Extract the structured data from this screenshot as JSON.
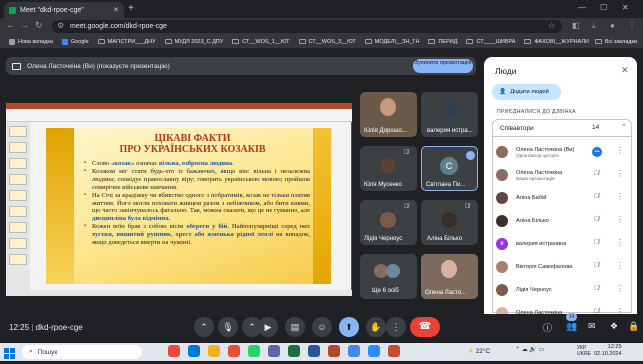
{
  "browser": {
    "tab_title": "Meet \"dkd-rpoe-cge\"",
    "url": "meet.google.com/dkd-rpoe-cge",
    "bookmarks": [
      "Нова вкладка",
      "Google",
      "МАГІСТРИ___ДНУ",
      "МУДЛ 2023_С ДПУ",
      "СТ__WOS_1__ЮТ",
      "СТ__WOS_3__ЮТ",
      "МОДЕЛІ__ЗН_ГН",
      "ПЕРИД",
      "СТ____ШИВРА",
      "ФАХОВІ__ЖУРНАЛИ"
    ],
    "bookmarks_all": "Всі закладки"
  },
  "presentation_bar": {
    "text": "Олена Ласточкіна (Ви) (показуєте презентацію)",
    "stop_button": "Зупинити презентацію"
  },
  "slide": {
    "title_line1": "ЦІКАВІ ФАКТИ",
    "title_line2": "ПРО УКРАЇНСЬКИХ КОЗАКІВ",
    "bullets": [
      {
        "parts": [
          [
            "Слово «",
            false
          ],
          [
            "козак",
            true
          ],
          [
            "» означає ",
            false
          ],
          [
            "вільна, озброєна людина",
            true
          ],
          [
            ".",
            false
          ]
        ]
      },
      {
        "parts": [
          [
            "Козаком міг стати будь-хто із бажаючих, якщо він: ",
            false
          ],
          [
            "вільна і незалежна людина; сповідує православну віру; говорить українською мовою; пройшов семирічне військове навчання.",
            false
          ]
        ]
      },
      {
        "parts": [
          [
            "На Січі за крадіжку чи вбивство одного з побратимів, козак не тільки платив життям. Його могли поховати живцем разом з небіжчиком, або бити киями, що часто закінчувалось фатально. Так, можна сказати, що це не гуманно, але ",
            false
          ],
          [
            "дисципліна була відмінна.",
            true
          ]
        ]
      },
      {
        "parts": [
          [
            "Кожен воїн брав з собою вісім ",
            false
          ],
          [
            "обереги у бій",
            true
          ],
          [
            ". Найпопулярніші серед них ",
            false
          ],
          [
            "хустки, вишитий рушник, хрест або жменька рідної землі",
            true
          ],
          [
            " на випадок, якщо доведеться вмерти на чужині.",
            false
          ]
        ]
      }
    ]
  },
  "tiles": [
    {
      "name": "Юлія Дорошо..."
    },
    {
      "name": "валерия истра..."
    },
    {
      "name": "Юля Мусенко"
    },
    {
      "name": "Світлана Пи...",
      "initial": "С"
    },
    {
      "name": "Лідія Черноус"
    },
    {
      "name": "Аліна Білько"
    },
    {
      "name": "Ще 6 осіб"
    },
    {
      "name": "Олена Ласто..."
    }
  ],
  "people": {
    "title": "Люди",
    "add_button": "Додати людей",
    "joined_label": "ПРИЄДНАЛИСЯ ДО ДЗВІНКА",
    "group_label": "Співавтори",
    "count": "14",
    "list": [
      {
        "name": "Олена Ласточкіна (Ви)",
        "sub": "Організатор зустрічі"
      },
      {
        "name": "Олена Ласточкіна",
        "sub": "Ваша презентація"
      },
      {
        "name": "Аліна Бабій",
        "sub": ""
      },
      {
        "name": "Аліна Білько",
        "sub": ""
      },
      {
        "name": "валерия истранина",
        "sub": "",
        "initial": "в"
      },
      {
        "name": "Вікторія Самофалова",
        "sub": ""
      },
      {
        "name": "Лідія Черноус",
        "sub": ""
      },
      {
        "name": "Олена Ласточкіна",
        "sub": ""
      }
    ]
  },
  "meeting": {
    "time": "12:25",
    "code": "dkd-rpoe-cge",
    "participant_badge": "14"
  },
  "taskbar": {
    "search": "Пошук",
    "temperature": "22°C",
    "lang_line1": "УКР",
    "lang_line2": "UKRE",
    "time": "12:25",
    "date": "02.10.2024"
  },
  "colors": {
    "accent": "#8ab4f8",
    "hangup": "#ea4335",
    "slide_title": "#b4381e"
  }
}
